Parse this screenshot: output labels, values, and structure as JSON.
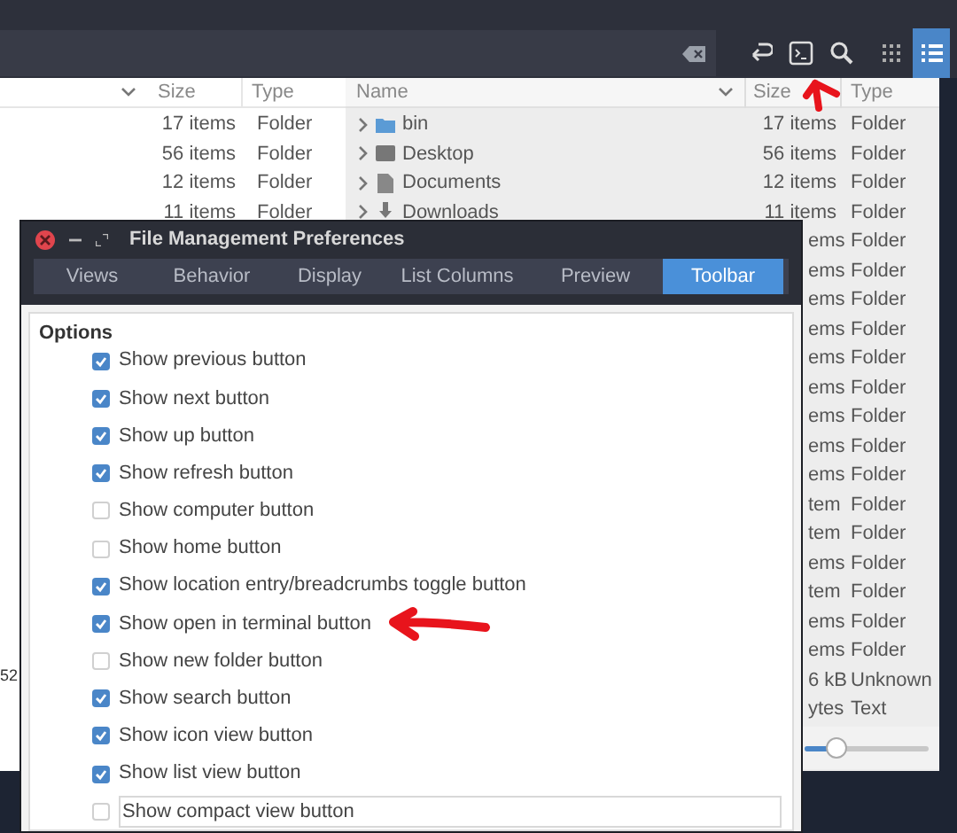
{
  "toolbar_buttons": [
    {
      "kind": "redo",
      "selected": false
    },
    {
      "kind": "terminal",
      "selected": false
    },
    {
      "kind": "search",
      "selected": false
    },
    {
      "kind": "grid",
      "selected": false
    },
    {
      "kind": "list",
      "selected": true
    }
  ],
  "left_pane": {
    "columns": [
      "Size",
      "Type"
    ],
    "rows": [
      {
        "size": "17 items",
        "type": "Folder"
      },
      {
        "size": "56 items",
        "type": "Folder"
      },
      {
        "size": "12 items",
        "type": "Folder"
      },
      {
        "size": "11 items",
        "type": "Folder"
      }
    ],
    "fragment": "52"
  },
  "right_pane": {
    "columns": [
      "Name",
      "Size",
      "Type"
    ],
    "rows": [
      {
        "name": "bin",
        "kind": "folder",
        "size": "17 items",
        "type": "Folder"
      },
      {
        "name": "Desktop",
        "kind": "desktop",
        "size": "56 items",
        "type": "Folder"
      },
      {
        "name": "Documents",
        "kind": "document",
        "size": "12 items",
        "type": "Folder"
      },
      {
        "name": "Downloads",
        "kind": "download",
        "size": "11 items",
        "type": "Folder"
      }
    ],
    "covered_rows": [
      {
        "size": "ems",
        "type": "Folder"
      },
      {
        "size": "ems",
        "type": "Folder"
      },
      {
        "size": "ems",
        "type": "Folder"
      },
      {
        "size": "ems",
        "type": "Folder"
      },
      {
        "size": "ems",
        "type": "Folder"
      },
      {
        "size": "ems",
        "type": "Folder"
      },
      {
        "size": "ems",
        "type": "Folder"
      },
      {
        "size": "ems",
        "type": "Folder"
      },
      {
        "size": "ems",
        "type": "Folder"
      },
      {
        "size": "tem",
        "type": "Folder"
      },
      {
        "size": "tem",
        "type": "Folder"
      },
      {
        "size": "ems",
        "type": "Folder"
      },
      {
        "size": "tem",
        "type": "Folder"
      },
      {
        "size": "ems",
        "type": "Folder"
      },
      {
        "size": "ems",
        "type": "Folder"
      },
      {
        "size": "6 kB",
        "type": "Unknown"
      },
      {
        "size": "ytes",
        "type": "Text"
      }
    ],
    "zoom_slider": {
      "level": 0.25
    }
  },
  "dialog": {
    "title": "File Management Preferences",
    "tabs": [
      {
        "label": "Views",
        "selected": false
      },
      {
        "label": "Behavior",
        "selected": false
      },
      {
        "label": "Display",
        "selected": false
      },
      {
        "label": "List Columns",
        "selected": false
      },
      {
        "label": "Preview",
        "selected": false
      },
      {
        "label": "Toolbar",
        "selected": true
      }
    ],
    "section": "Options",
    "options": [
      {
        "label": "Show previous button",
        "checked": true,
        "annotated": false
      },
      {
        "label": "Show next button",
        "checked": true,
        "annotated": false
      },
      {
        "label": "Show up button",
        "checked": true,
        "annotated": false
      },
      {
        "label": "Show refresh button",
        "checked": true,
        "annotated": false
      },
      {
        "label": "Show computer button",
        "checked": false,
        "annotated": false
      },
      {
        "label": "Show home button",
        "checked": false,
        "annotated": false
      },
      {
        "label": "Show location entry/breadcrumbs toggle button",
        "checked": true,
        "annotated": false
      },
      {
        "label": "Show open in terminal button",
        "checked": true,
        "annotated": true
      },
      {
        "label": "Show new folder button",
        "checked": false,
        "annotated": false
      },
      {
        "label": "Show search button",
        "checked": true,
        "annotated": false
      },
      {
        "label": "Show icon view button",
        "checked": true,
        "annotated": false
      },
      {
        "label": "Show list view button",
        "checked": true,
        "annotated": false
      },
      {
        "label": "Show compact view button",
        "checked": false,
        "annotated": false,
        "focused": true
      }
    ]
  }
}
